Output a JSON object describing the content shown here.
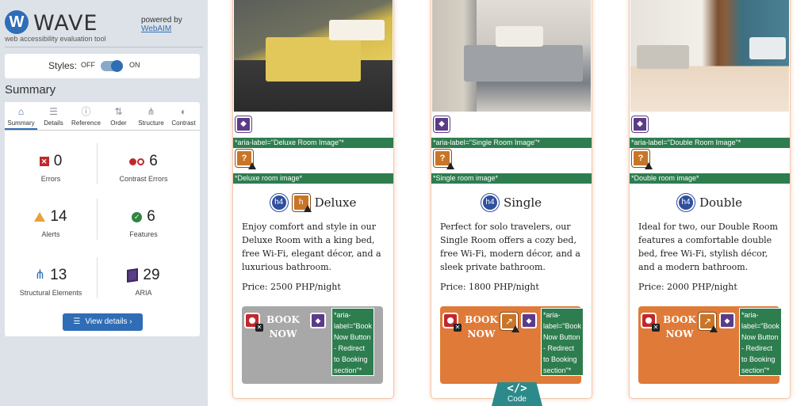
{
  "brand": {
    "logo_letter": "W",
    "name": "WAVE",
    "tagline": "web accessibility evaluation tool",
    "powered_by": "powered by",
    "powered_link": "WebAIM"
  },
  "styles": {
    "label": "Styles:",
    "off": "OFF",
    "on": "ON",
    "enabled": true
  },
  "summary_title": "Summary",
  "tabs": [
    {
      "label": "Summary",
      "icon": "home-icon",
      "active": true
    },
    {
      "label": "Details",
      "icon": "list-icon"
    },
    {
      "label": "Reference",
      "icon": "info-icon"
    },
    {
      "label": "Order",
      "icon": "order-icon"
    },
    {
      "label": "Structure",
      "icon": "structure-icon"
    },
    {
      "label": "Contrast",
      "icon": "contrast-icon"
    }
  ],
  "stats": {
    "errors": {
      "value": "0",
      "label": "Errors"
    },
    "contrast": {
      "value": "6",
      "label": "Contrast Errors"
    },
    "alerts": {
      "value": "14",
      "label": "Alerts"
    },
    "features": {
      "value": "6",
      "label": "Features"
    },
    "structural": {
      "value": "13",
      "label": "Structural Elements"
    },
    "aria": {
      "value": "29",
      "label": "ARIA"
    }
  },
  "view_details": "View details ›",
  "cards": [
    {
      "aria_image": "*aria-label=\"Deluxe Room Image\"*",
      "alt_text": "*Deluxe room image*",
      "h4": "h4",
      "title": "Deluxe",
      "desc": "Enjoy comfort and style in our Deluxe Room with a king bed, free Wi-Fi, elegant décor, and a luxurious bathroom.",
      "price": "Price: 2500 PHP/night",
      "book_line1": "BOOK",
      "book_line2": "NOW",
      "aria_button": "*aria-label=\"Book Now Button - Redirect to Booking section\"*"
    },
    {
      "aria_image": "*aria-label=\"Single Room Image\"*",
      "alt_text": "*Single room image*",
      "h4": "h4",
      "title": "Single",
      "desc": "Perfect for solo travelers, our Single Room offers a cozy bed, free Wi-Fi, modern décor, and a sleek private bathroom.",
      "price": "Price: 1800 PHP/night",
      "book_line1": "BOOK",
      "book_line2": "NOW",
      "aria_button": "*aria-label=\"Book Now Button - Redirect to Booking section\"*"
    },
    {
      "aria_image": "*aria-label=\"Double Room Image\"*",
      "alt_text": "*Double room image*",
      "h4": "h4",
      "title": "Double",
      "desc": "Ideal for two, our Double Room features a comfortable double bed, free Wi-Fi, stylish décor, and a modern bathroom.",
      "price": "Price: 2000 PHP/night",
      "book_line1": "BOOK",
      "book_line2": "NOW",
      "aria_button": "*aria-label=\"Book Now Button - Redirect to Booking section\"*"
    }
  ],
  "code_tab": {
    "icon": "</>",
    "label": "Code"
  },
  "colors": {
    "wave_blue": "#2f6db6",
    "error_red": "#c0282d",
    "alert_orange": "#c97528",
    "aria_purple": "#5b3c88",
    "feature_green": "#2e7d4f",
    "button_orange": "#e07a38",
    "button_gray": "#a8a8a8"
  }
}
